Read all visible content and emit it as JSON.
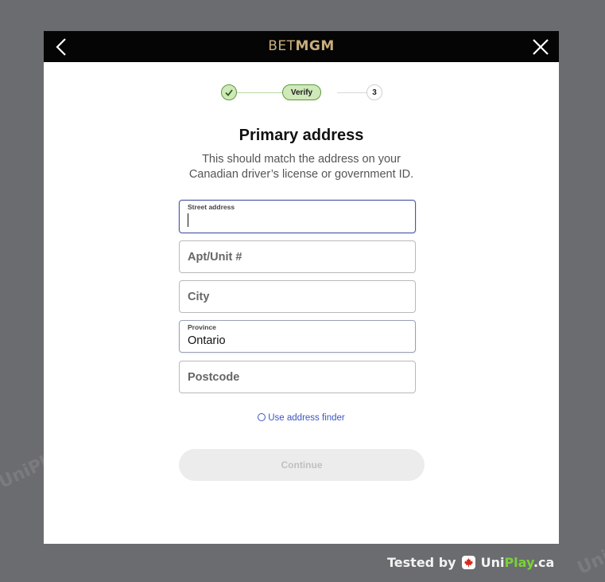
{
  "brand": {
    "part1": "BET",
    "part2": "MGM",
    "color": "#c9ae7c"
  },
  "stepper": {
    "current_label": "Verify",
    "next_label": "3"
  },
  "form": {
    "title": "Primary address",
    "subtitle_line1": "This should match the address on your",
    "subtitle_line2": "Canadian driver’s license or government ID.",
    "street": {
      "label": "Street address",
      "value": ""
    },
    "apt": {
      "placeholder": "Apt/Unit #"
    },
    "city": {
      "placeholder": "City"
    },
    "province": {
      "label": "Province",
      "value": "Ontario"
    },
    "postcode": {
      "placeholder": "Postcode"
    },
    "finder_link": "Use address finder",
    "continue_label": "Continue"
  },
  "footer": {
    "tested_by": "Tested by",
    "uni": "Uni",
    "play": "Play",
    "domain": ".ca"
  },
  "watermark": "UniPlay.ca",
  "colors": {
    "accent": "#3b56c4",
    "success": "#5d9a3b",
    "overlay": "#6b6c6f"
  }
}
